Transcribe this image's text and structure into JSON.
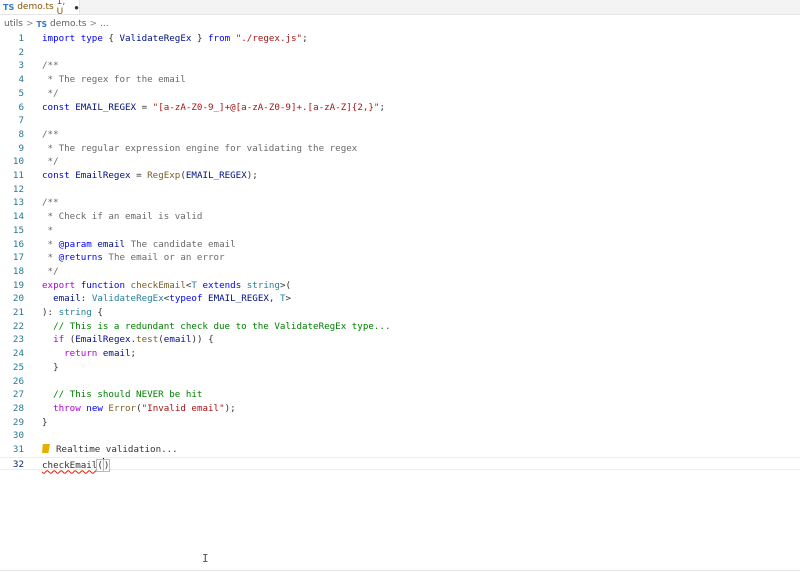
{
  "tab": {
    "badge": "TS",
    "file": "demo.ts",
    "status": "1, U",
    "dirty": "●"
  },
  "breadcrumb": {
    "folder": "utils",
    "sep": ">",
    "ts": "TS",
    "file": "demo.ts",
    "more": "..."
  },
  "lines": [
    {
      "n": "1",
      "segs": [
        [
          "kw",
          "import "
        ],
        [
          "kw",
          "type "
        ],
        [
          "",
          "{ "
        ],
        [
          "va",
          "ValidateRegEx"
        ],
        [
          "",
          " } "
        ],
        [
          "kw",
          "from "
        ],
        [
          "str",
          "\"./regex.js\""
        ],
        [
          "",
          ";"
        ]
      ]
    },
    {
      "n": "2",
      "segs": []
    },
    {
      "n": "3",
      "segs": [
        [
          "doc",
          "/**"
        ]
      ]
    },
    {
      "n": "4",
      "segs": [
        [
          "doc",
          " * The regex for the email"
        ]
      ]
    },
    {
      "n": "5",
      "segs": [
        [
          "doc",
          " */"
        ]
      ]
    },
    {
      "n": "6",
      "segs": [
        [
          "kw",
          "const "
        ],
        [
          "va",
          "EMAIL_REGEX"
        ],
        [
          "",
          " = "
        ],
        [
          "str",
          "\"[a-zA-Z0-9_]+@[a-zA-Z0-9]+.[a-zA-Z]{2,}\""
        ],
        [
          "",
          ";"
        ]
      ]
    },
    {
      "n": "7",
      "segs": []
    },
    {
      "n": "8",
      "segs": [
        [
          "doc",
          "/**"
        ]
      ]
    },
    {
      "n": "9",
      "segs": [
        [
          "doc",
          " * The regular expression engine for validating the regex"
        ]
      ]
    },
    {
      "n": "10",
      "segs": [
        [
          "doc",
          " */"
        ]
      ]
    },
    {
      "n": "11",
      "segs": [
        [
          "kw",
          "const "
        ],
        [
          "va",
          "EmailRegex"
        ],
        [
          "",
          " = "
        ],
        [
          "fn",
          "RegExp"
        ],
        [
          "",
          "("
        ],
        [
          "va",
          "EMAIL_REGEX"
        ],
        [
          "",
          ");"
        ]
      ]
    },
    {
      "n": "12",
      "segs": []
    },
    {
      "n": "13",
      "segs": [
        [
          "doc",
          "/**"
        ]
      ]
    },
    {
      "n": "14",
      "segs": [
        [
          "doc",
          " * Check if an email is valid"
        ]
      ]
    },
    {
      "n": "15",
      "segs": [
        [
          "doc",
          " *"
        ]
      ]
    },
    {
      "n": "16",
      "segs": [
        [
          "doc",
          " * "
        ],
        [
          "tag",
          "@param"
        ],
        [
          "doc",
          " "
        ],
        [
          "va",
          "email"
        ],
        [
          "doc",
          " The candidate email"
        ]
      ]
    },
    {
      "n": "17",
      "segs": [
        [
          "doc",
          " * "
        ],
        [
          "tag",
          "@returns"
        ],
        [
          "doc",
          " The email or an error"
        ]
      ]
    },
    {
      "n": "18",
      "segs": [
        [
          "doc",
          " */"
        ]
      ]
    },
    {
      "n": "19",
      "segs": [
        [
          "kw2",
          "export "
        ],
        [
          "kw",
          "function "
        ],
        [
          "fn",
          "checkEmail"
        ],
        [
          "",
          "<"
        ],
        [
          "ty",
          "T"
        ],
        [
          "",
          " "
        ],
        [
          "kw",
          "extends "
        ],
        [
          "ty",
          "string"
        ],
        [
          "",
          ">("
        ]
      ]
    },
    {
      "n": "20",
      "segs": [
        [
          "",
          "  "
        ],
        [
          "va",
          "email"
        ],
        [
          "",
          ": "
        ],
        [
          "ty",
          "ValidateRegEx"
        ],
        [
          "",
          "<"
        ],
        [
          "kw",
          "typeof "
        ],
        [
          "va",
          "EMAIL_REGEX"
        ],
        [
          "",
          ", "
        ],
        [
          "ty",
          "T"
        ],
        [
          "",
          ">"
        ]
      ]
    },
    {
      "n": "21",
      "segs": [
        [
          "",
          "): "
        ],
        [
          "ty",
          "string"
        ],
        [
          "",
          " {"
        ]
      ]
    },
    {
      "n": "22",
      "segs": [
        [
          "",
          "  "
        ],
        [
          "co",
          "// This is a redundant check due to the ValidateRegEx type..."
        ]
      ]
    },
    {
      "n": "23",
      "segs": [
        [
          "",
          "  "
        ],
        [
          "kw2",
          "if "
        ],
        [
          "",
          "("
        ],
        [
          "va",
          "EmailRegex"
        ],
        [
          "",
          "."
        ],
        [
          "fn",
          "test"
        ],
        [
          "",
          "("
        ],
        [
          "va",
          "email"
        ],
        [
          "",
          ")) {"
        ]
      ]
    },
    {
      "n": "24",
      "segs": [
        [
          "",
          "    "
        ],
        [
          "kw2",
          "return "
        ],
        [
          "va",
          "email"
        ],
        [
          "",
          ";"
        ]
      ]
    },
    {
      "n": "25",
      "segs": [
        [
          "",
          "  }"
        ]
      ]
    },
    {
      "n": "26",
      "segs": []
    },
    {
      "n": "27",
      "segs": [
        [
          "",
          "  "
        ],
        [
          "co",
          "// This should NEVER be hit"
        ]
      ]
    },
    {
      "n": "28",
      "segs": [
        [
          "",
          "  "
        ],
        [
          "kw2",
          "throw "
        ],
        [
          "kw",
          "new "
        ],
        [
          "fn",
          "Error"
        ],
        [
          "",
          "("
        ],
        [
          "str",
          "\"Invalid email\""
        ],
        [
          "",
          ");"
        ]
      ]
    },
    {
      "n": "29",
      "segs": [
        [
          "",
          "}"
        ]
      ]
    },
    {
      "n": "30",
      "segs": []
    },
    {
      "n": "31",
      "segs": [
        [
          "bullet",
          ""
        ],
        [
          "",
          "Realtime validation..."
        ]
      ]
    },
    {
      "n": "32",
      "segs": [
        [
          "squiggle",
          "checkEmail"
        ],
        [
          "bracket",
          "("
        ],
        [
          "caret",
          ""
        ],
        [
          "bracket",
          ")"
        ]
      ]
    }
  ]
}
